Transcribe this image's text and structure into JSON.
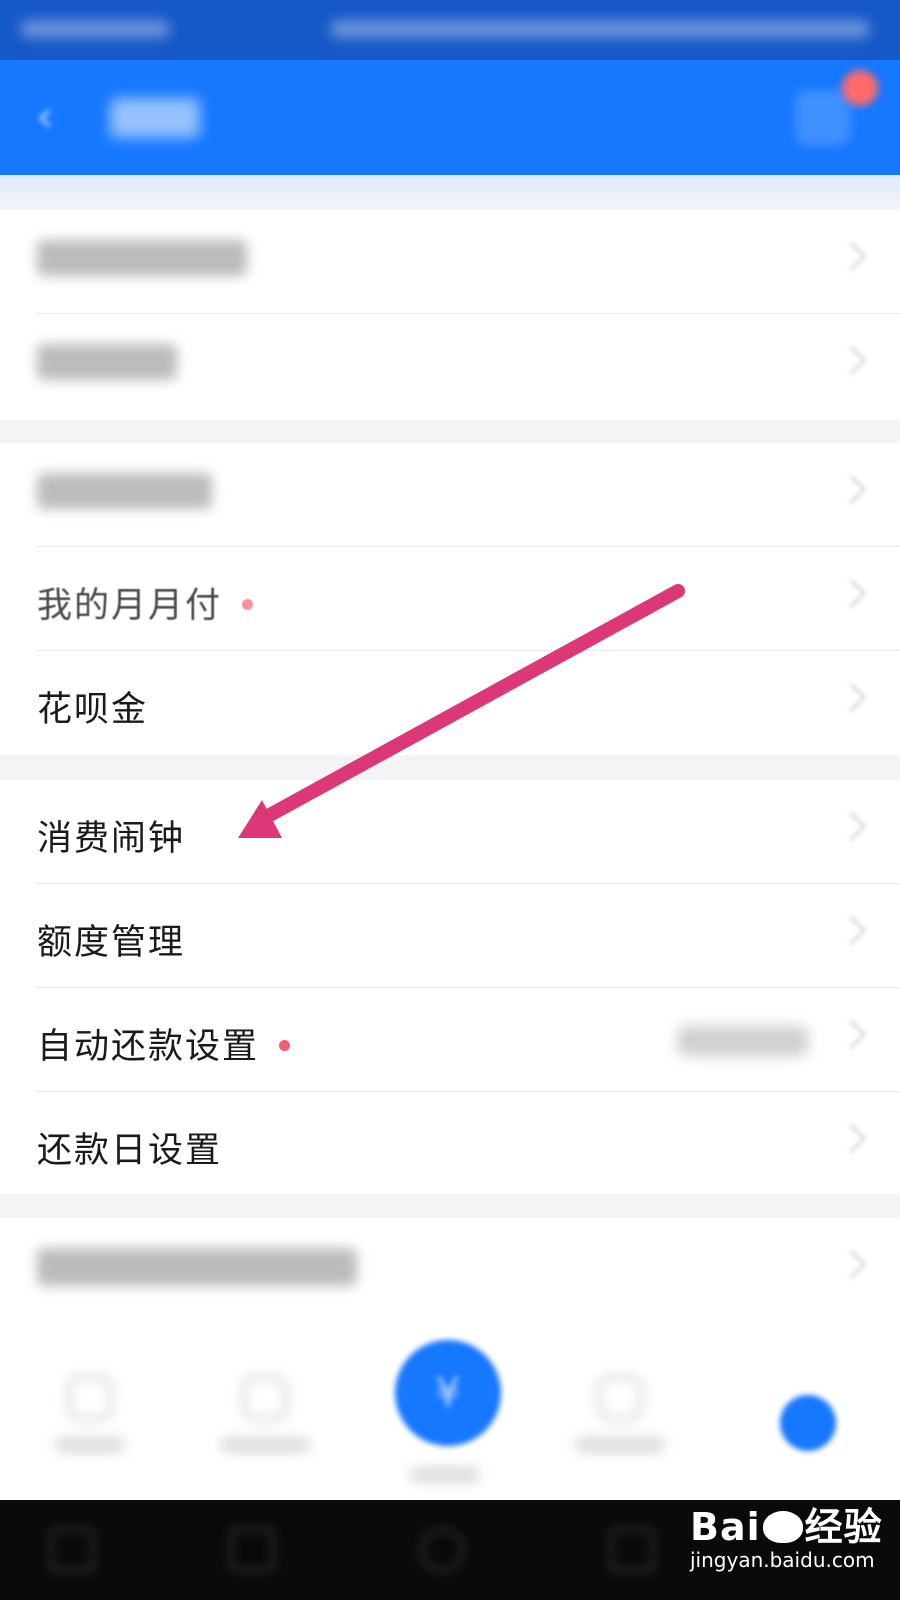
{
  "menu": {
    "group2": {
      "items": [
        {
          "label": "我的月月付",
          "has_dot": true
        },
        {
          "label": "花呗金"
        }
      ]
    },
    "group3": {
      "items": [
        {
          "label": "消费闹钟"
        },
        {
          "label": "额度管理"
        },
        {
          "label": "自动还款设置",
          "has_dot": true
        },
        {
          "label": "还款日设置"
        }
      ]
    }
  },
  "colors": {
    "header_blue": "#1677ff",
    "status_blue": "#1758c7",
    "badge_red": "#f25f6f",
    "annotation_arrow": "#dc3776"
  },
  "annotation": {
    "type": "arrow",
    "points_to": "消费闹钟"
  },
  "watermark": {
    "brand_a": "Bai",
    "brand_b": "经验",
    "url": "jingyan.baidu.com"
  }
}
